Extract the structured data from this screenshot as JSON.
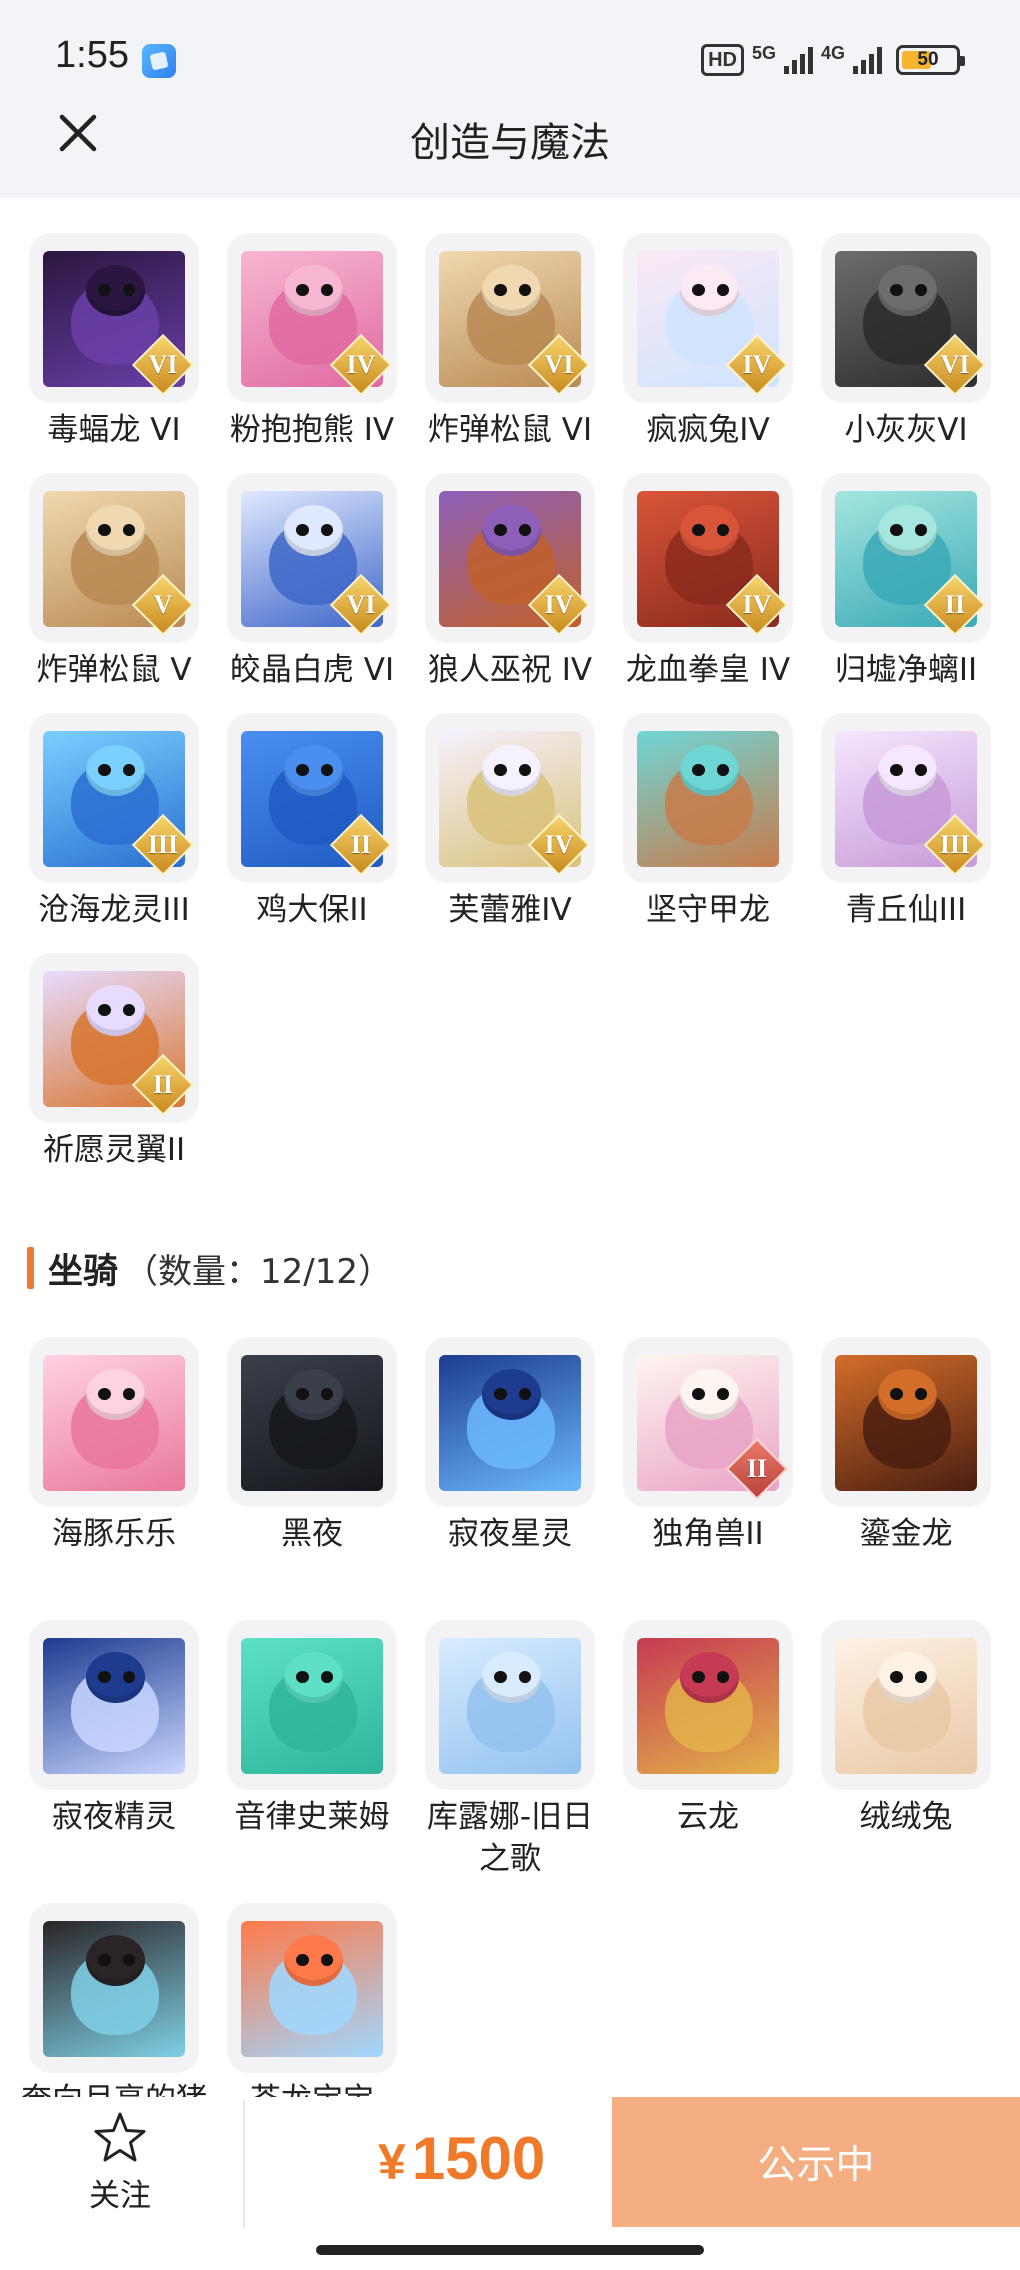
{
  "status_bar": {
    "time": "1:55",
    "hd": "HD",
    "net1": "5G",
    "net2": "4G",
    "battery": "50"
  },
  "nav": {
    "title": "创造与魔法"
  },
  "pets": [
    {
      "name": "毒蝠龙 VI",
      "rank": "VI",
      "colors": [
        "#2a1640",
        "#6b3fa8"
      ],
      "icon": "dragon-icon"
    },
    {
      "name": "粉抱抱熊 IV",
      "rank": "IV",
      "colors": [
        "#f7b7d2",
        "#e06aa0"
      ],
      "icon": "bear-icon"
    },
    {
      "name": "炸弹松鼠 VI",
      "rank": "VI",
      "colors": [
        "#f0d9b0",
        "#b98a54"
      ],
      "icon": "squirrel-icon"
    },
    {
      "name": "疯疯兔IV",
      "rank": "IV",
      "colors": [
        "#fbe9f4",
        "#cfe4ff"
      ],
      "icon": "rabbit-icon"
    },
    {
      "name": "小灰灰VI",
      "rank": "VI",
      "colors": [
        "#6d6d70",
        "#2c2c2e"
      ],
      "icon": "wolf-icon"
    },
    {
      "name": "炸弹松鼠 V",
      "rank": "V",
      "colors": [
        "#f0d9b0",
        "#b98a54"
      ],
      "icon": "squirrel-icon"
    },
    {
      "name": "皎晶白虎 VI",
      "rank": "VI",
      "colors": [
        "#dfe9ff",
        "#3f67c9"
      ],
      "icon": "tiger-icon"
    },
    {
      "name": "狼人巫祝 IV",
      "rank": "IV",
      "colors": [
        "#8d5fb8",
        "#c0602a"
      ],
      "icon": "wolf-icon"
    },
    {
      "name": "龙血拳皇 IV",
      "rank": "IV",
      "colors": [
        "#d9553a",
        "#8a2a1d"
      ],
      "icon": "beast-icon"
    },
    {
      "name": "归墟净螭II",
      "rank": "II",
      "colors": [
        "#a5e6df",
        "#3aa9b7"
      ],
      "icon": "dragon-icon"
    },
    {
      "name": "沧海龙灵III",
      "rank": "III",
      "colors": [
        "#7ad0ff",
        "#2b6fd1"
      ],
      "icon": "spirit-icon"
    },
    {
      "name": "鸡大保II",
      "rank": "II",
      "colors": [
        "#4a8ff0",
        "#1f5bc2"
      ],
      "icon": "chicken-icon"
    },
    {
      "name": "芙蕾雅IV",
      "rank": "IV",
      "colors": [
        "#f6f1ff",
        "#d9c27a"
      ],
      "icon": "spirit-icon"
    },
    {
      "name": "坚守甲龙",
      "rank": "",
      "colors": [
        "#6fd6d6",
        "#c87b4a"
      ],
      "icon": "dinosaur-icon"
    },
    {
      "name": "青丘仙III",
      "rank": "III",
      "colors": [
        "#f5e7ff",
        "#c79ad8"
      ],
      "icon": "fox-icon"
    },
    {
      "name": "祈愿灵翼II",
      "rank": "II",
      "colors": [
        "#e7dcff",
        "#d7762f"
      ],
      "icon": "bird-icon"
    }
  ],
  "mounts_section": {
    "title": "坐骑",
    "count": "（数量：12/12）"
  },
  "mounts": [
    {
      "name": "海豚乐乐",
      "rank": "",
      "colors": [
        "#ffd2e2",
        "#e9779c"
      ],
      "icon": "dolphin-icon"
    },
    {
      "name": "黑夜",
      "rank": "",
      "colors": [
        "#3a3f4a",
        "#15171c"
      ],
      "icon": "dragon-icon"
    },
    {
      "name": "寂夜星灵",
      "rank": "",
      "colors": [
        "#1d3c8f",
        "#6bb8ff"
      ],
      "icon": "wolf-icon"
    },
    {
      "name": "独角兽II",
      "rank": "II",
      "colors": [
        "#fff5f0",
        "#e9a3c6"
      ],
      "icon": "unicorn-icon"
    },
    {
      "name": "鎏金龙",
      "rank": "",
      "colors": [
        "#d36d2a",
        "#4a1e10"
      ],
      "icon": "dragon-icon"
    },
    {
      "name": "寂夜精灵",
      "rank": "",
      "colors": [
        "#1d3c8f",
        "#c9d6ff"
      ],
      "icon": "wolf-icon"
    },
    {
      "name": "音律史莱姆",
      "rank": "",
      "colors": [
        "#5de0c6",
        "#2fb59c"
      ],
      "icon": "slime-icon"
    },
    {
      "name": "库露娜-旧日之歌",
      "rank": "",
      "colors": [
        "#d8ecff",
        "#93c2ef"
      ],
      "icon": "sheep-icon"
    },
    {
      "name": "云龙",
      "rank": "",
      "colors": [
        "#c63a53",
        "#e3b24a"
      ],
      "icon": "dragon-icon"
    },
    {
      "name": "绒绒兔",
      "rank": "",
      "colors": [
        "#fff1e4",
        "#e9c9a6"
      ],
      "icon": "rabbit-icon"
    },
    {
      "name": "奔向月亮的猪猪侠",
      "rank": "",
      "colors": [
        "#2a2426",
        "#7fd0e6"
      ],
      "icon": "pig-icon"
    },
    {
      "name": "苍龙宝宝",
      "rank": "",
      "colors": [
        "#ff7a4a",
        "#9fd8ff"
      ],
      "icon": "dragon-icon"
    }
  ],
  "bottom": {
    "follow_label": "关注",
    "currency": "¥",
    "price": "1500",
    "cta_label": "公示中"
  }
}
